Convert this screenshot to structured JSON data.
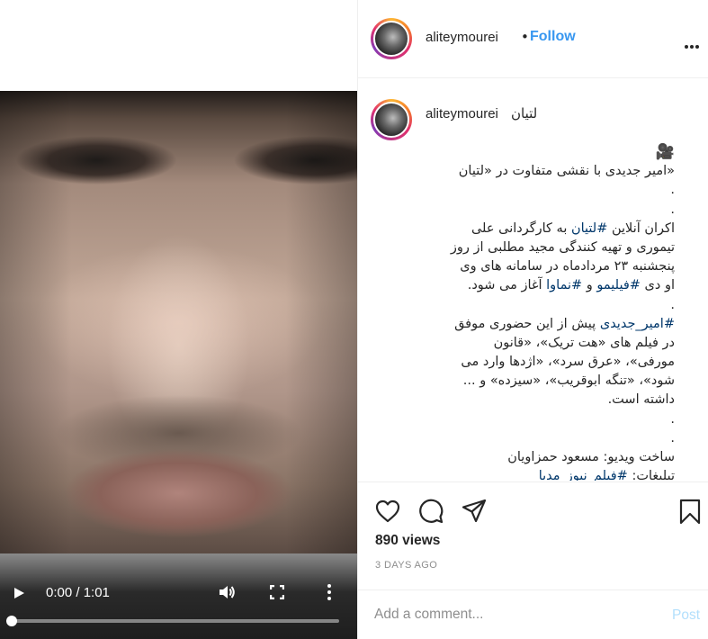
{
  "header": {
    "username": "aliteymourei",
    "separator": "•",
    "follow_label": "Follow",
    "more_icon": "more-horizontal-icon"
  },
  "video": {
    "time_display": "0:00 / 1:01",
    "progress": 0.0,
    "icons": [
      "play-icon",
      "volume-icon",
      "fullscreen-icon",
      "more-vertical-icon"
    ]
  },
  "caption": {
    "username": "aliteymourei",
    "title": "لتیان",
    "lines": [
      {
        "text": "🎥",
        "emoji": true
      },
      {
        "text": "«امیر جدیدی با نقشی متفاوت در «لتیان"
      },
      {
        "text": "."
      },
      {
        "text": "."
      },
      {
        "parts": [
          {
            "t": "اکران آنلاین "
          },
          {
            "t": "#لتیان",
            "tag": true
          },
          {
            "t": " به کارگردانی علی"
          }
        ]
      },
      {
        "text": "تیموری و تهیه کنندگی مجید مطلبی از روز"
      },
      {
        "text": "پنجشنبه ۲۳ مردادماه در سامانه های وی"
      },
      {
        "parts": [
          {
            "t": "او دی "
          },
          {
            "t": "#فیلیمو",
            "tag": true
          },
          {
            "t": " و "
          },
          {
            "t": "#نماوا",
            "tag": true
          },
          {
            "t": " آغاز می شود."
          }
        ]
      },
      {
        "text": "."
      },
      {
        "parts": [
          {
            "t": "#امیر_جدیدی",
            "tag": true
          },
          {
            "t": " پیش از این حضوری موفق"
          }
        ]
      },
      {
        "text": "در فیلم های «هت تریک»، «قانون"
      },
      {
        "text": "مورفی»، «عرق سرد»، «اژدها وارد می"
      },
      {
        "text": "شود»، «تنگه ابوقریب»، «سیزده» و ..."
      },
      {
        "text": "داشته است."
      },
      {
        "text": "."
      },
      {
        "text": "."
      },
      {
        "text": "ساخت ویدیو: مسعود حمزاویان"
      },
      {
        "parts": [
          {
            "t": "تبلیغات: "
          },
          {
            "t": "#فیلم_نیوز_مدیا",
            "tag": true
          }
        ]
      }
    ]
  },
  "actions": {
    "icons": [
      "heart-icon",
      "comment-icon",
      "share-icon",
      "bookmark-icon"
    ],
    "views": "890 views",
    "date": "3 DAYS AGO"
  },
  "comment": {
    "placeholder": "Add a comment...",
    "post_label": "Post"
  },
  "colors": {
    "link_blue": "#3897f0",
    "hashtag": "#00376b",
    "post_disabled": "#b2dffc",
    "muted": "#8e8e8e"
  }
}
